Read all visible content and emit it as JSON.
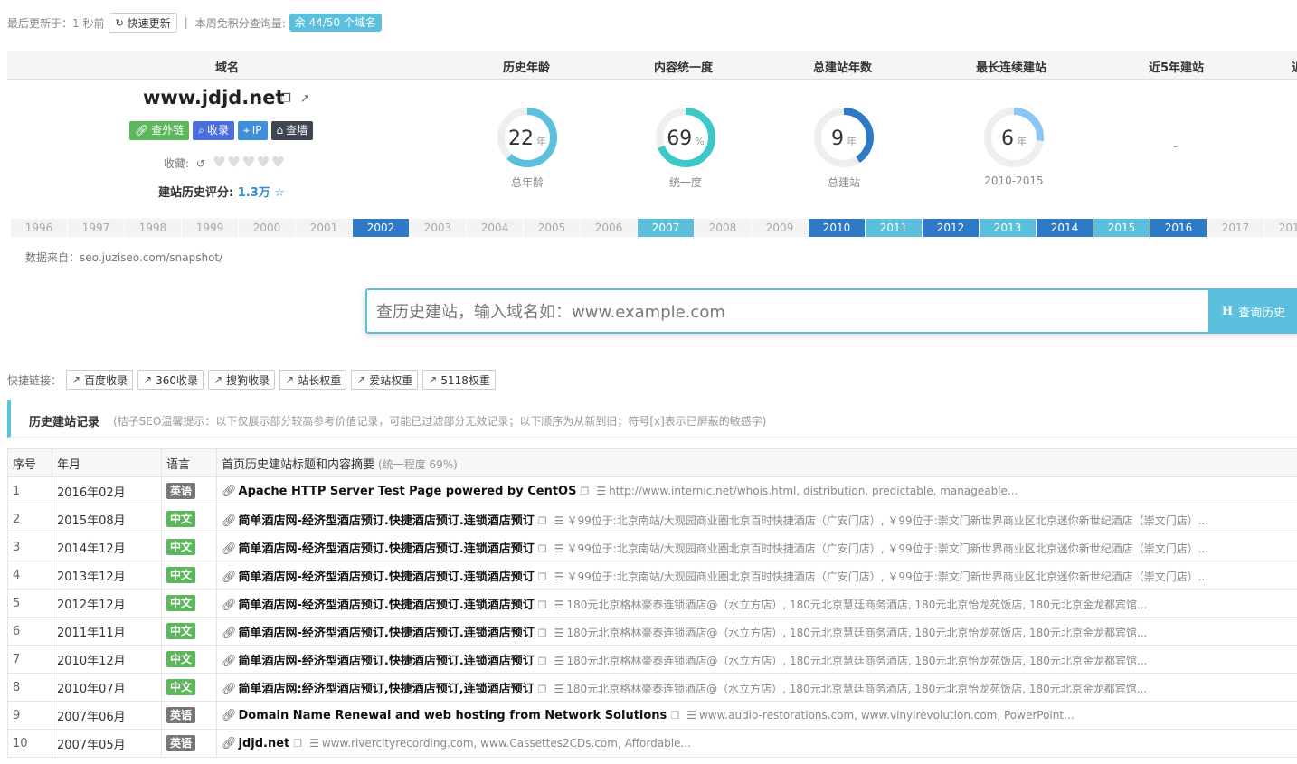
{
  "topbar": {
    "updated": "最后更新于：1 秒前",
    "refresh_label": "快速更新",
    "divider": "|",
    "quota_label": "本周免积分查询量:",
    "quota_badge": "余 44/50 个域名"
  },
  "summary": {
    "headers": [
      "域名",
      "历史年龄",
      "内容统一度",
      "总建站年数",
      "最长连续建站",
      "近5年建站",
      "近"
    ],
    "domain": "www.jdjd.net",
    "buttons": [
      {
        "label": "查外链",
        "icon": "link-icon"
      },
      {
        "label": "收录",
        "icon": "search-icon"
      },
      {
        "label": "IP",
        "icon": "map-pin-icon"
      },
      {
        "label": "查墙",
        "icon": "lock-icon"
      }
    ],
    "fav_label": "收藏:",
    "score_label": "建站历史评分:",
    "score_value": "1.3万",
    "rings": [
      {
        "value": "22",
        "unit": "年",
        "caption": "总年龄",
        "fraction": 0.62,
        "color": "#5bc0de"
      },
      {
        "value": "69",
        "unit": "%",
        "caption": "统一度",
        "fraction": 0.69,
        "color": "#3ec7c7"
      },
      {
        "value": "9",
        "unit": "年",
        "caption": "总建站",
        "fraction": 0.41,
        "color": "#2f7ac6"
      },
      {
        "value": "6",
        "unit": "年",
        "caption": "2010-2015",
        "fraction": 0.27,
        "color": "#8cc6f2"
      }
    ],
    "recent5": "-"
  },
  "years": [
    {
      "y": "1996",
      "s": 0
    },
    {
      "y": "1997",
      "s": 0
    },
    {
      "y": "1998",
      "s": 0
    },
    {
      "y": "1999",
      "s": 0
    },
    {
      "y": "2000",
      "s": 0
    },
    {
      "y": "2001",
      "s": 0
    },
    {
      "y": "2002",
      "s": 1
    },
    {
      "y": "2003",
      "s": 0
    },
    {
      "y": "2004",
      "s": 0
    },
    {
      "y": "2005",
      "s": 0
    },
    {
      "y": "2006",
      "s": 0
    },
    {
      "y": "2007",
      "s": 2
    },
    {
      "y": "2008",
      "s": 0
    },
    {
      "y": "2009",
      "s": 0
    },
    {
      "y": "2010",
      "s": 1
    },
    {
      "y": "2011",
      "s": 2
    },
    {
      "y": "2012",
      "s": 1
    },
    {
      "y": "2013",
      "s": 2
    },
    {
      "y": "2014",
      "s": 1
    },
    {
      "y": "2015",
      "s": 2
    },
    {
      "y": "2016",
      "s": 1
    },
    {
      "y": "2017",
      "s": 0
    },
    {
      "y": "2018",
      "s": 0
    }
  ],
  "source": "数据来自：seo.juziseo.com/snapshot/",
  "search": {
    "placeholder": "查历史建站，输入域名如：www.example.com",
    "button_label": "查询历史",
    "button_icon": "H"
  },
  "quick_links": {
    "label": "快捷链接：",
    "items": [
      "百度收录",
      "360收录",
      "搜狗收录",
      "站长权重",
      "爱站权重",
      "5118权重"
    ]
  },
  "history": {
    "title": "历史建站记录",
    "hint": "(桔子SEO温馨提示：以下仅展示部分较高参考价值记录，可能已过滤部分无效记录；以下顺序为从新到旧；符号[x]表示已屏蔽的敏感字)",
    "columns": [
      "序号",
      "年月",
      "语言",
      "首页历史建站标题和内容摘要"
    ],
    "col_sub": "(统一程度 69%)",
    "rows": [
      {
        "no": "1",
        "ym": "2016年02月",
        "lang": "英语",
        "lang_type": "en",
        "title": "Apache HTTP Server Test Page powered by CentOS",
        "summary": "http://www.internic.net/whois.html, distribution, predictable, manageable..."
      },
      {
        "no": "2",
        "ym": "2015年08月",
        "lang": "中文",
        "lang_type": "zh",
        "title": "简单酒店网-经济型酒店预订.快捷酒店预订.连锁酒店预订",
        "summary": "￥99位于:北京南站/大观园商业圈北京百时快捷酒店（广安门店）, ￥99位于:崇文门新世界商业区北京迷你新世纪酒店（崇文门店）..."
      },
      {
        "no": "3",
        "ym": "2014年12月",
        "lang": "中文",
        "lang_type": "zh",
        "title": "简单酒店网-经济型酒店预订.快捷酒店预订.连锁酒店预订",
        "summary": "￥99位于:北京南站/大观园商业圈北京百时快捷酒店（广安门店）, ￥99位于:崇文门新世界商业区北京迷你新世纪酒店（崇文门店）..."
      },
      {
        "no": "4",
        "ym": "2013年12月",
        "lang": "中文",
        "lang_type": "zh",
        "title": "简单酒店网-经济型酒店预订.快捷酒店预订.连锁酒店预订",
        "summary": "￥99位于:北京南站/大观园商业圈北京百时快捷酒店（广安门店）, ￥99位于:崇文门新世界商业区北京迷你新世纪酒店（崇文门店）..."
      },
      {
        "no": "5",
        "ym": "2012年12月",
        "lang": "中文",
        "lang_type": "zh",
        "title": "简单酒店网-经济型酒店预订.快捷酒店预订.连锁酒店预订",
        "summary": "180元北京格林豪泰连锁酒店@（水立方店）, 180元北京慧廷商务酒店, 180元北京怡龙苑饭店, 180元北京金龙都宾馆..."
      },
      {
        "no": "6",
        "ym": "2011年11月",
        "lang": "中文",
        "lang_type": "zh",
        "title": "简单酒店网-经济型酒店预订.快捷酒店预订.连锁酒店预订",
        "summary": "180元北京格林豪泰连锁酒店@（水立方店）, 180元北京慧廷商务酒店, 180元北京怡龙苑饭店, 180元北京金龙都宾馆..."
      },
      {
        "no": "7",
        "ym": "2010年12月",
        "lang": "中文",
        "lang_type": "zh",
        "title": "简单酒店网-经济型酒店预订.快捷酒店预订.连锁酒店预订",
        "summary": "180元北京格林豪泰连锁酒店@（水立方店）, 180元北京慧廷商务酒店, 180元北京怡龙苑饭店, 180元北京金龙都宾馆..."
      },
      {
        "no": "8",
        "ym": "2010年07月",
        "lang": "中文",
        "lang_type": "zh",
        "title": "简单酒店网:经济型酒店预订,快捷酒店预订,连锁酒店预订",
        "summary": "180元北京格林豪泰连锁酒店@（水立方店）, 180元北京慧廷商务酒店, 180元北京怡龙苑饭店, 180元北京金龙都宾馆..."
      },
      {
        "no": "9",
        "ym": "2007年06月",
        "lang": "英语",
        "lang_type": "en",
        "title": "Domain Name Renewal and web hosting from Network Solutions",
        "summary": "www.audio-restorations.com, www.vinylrevolution.com, PowerPoint..."
      },
      {
        "no": "10",
        "ym": "2007年05月",
        "lang": "英语",
        "lang_type": "en",
        "title": "jdjd.net",
        "summary": "www.rivercityrecording.com, www.Cassettes2CDs.com, Affordable..."
      }
    ]
  }
}
